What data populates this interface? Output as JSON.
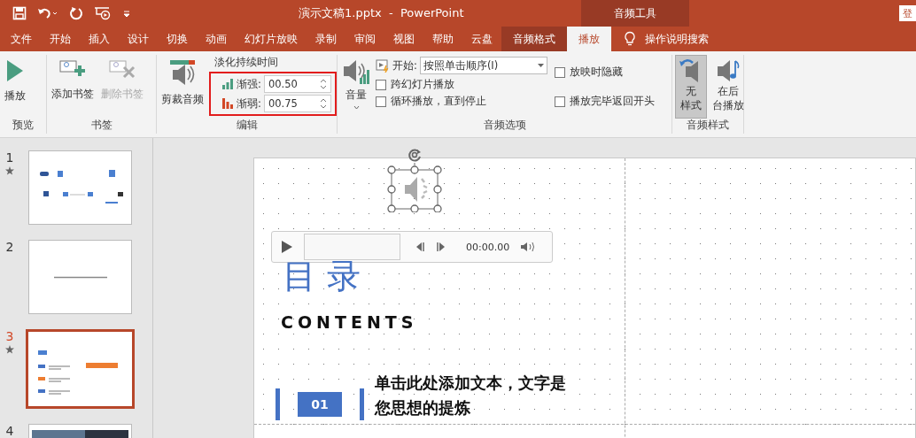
{
  "title_bar": {
    "title": "演示文稿1.pptx  -  PowerPoint",
    "context_group": "音频工具",
    "account": "登"
  },
  "tabs": [
    {
      "label": "文件",
      "selected": false,
      "contextual": false
    },
    {
      "label": "开始",
      "selected": false,
      "contextual": false
    },
    {
      "label": "插入",
      "selected": false,
      "contextual": false
    },
    {
      "label": "设计",
      "selected": false,
      "contextual": false
    },
    {
      "label": "切换",
      "selected": false,
      "contextual": false
    },
    {
      "label": "动画",
      "selected": false,
      "contextual": false
    },
    {
      "label": "幻灯片放映",
      "selected": false,
      "contextual": false
    },
    {
      "label": "录制",
      "selected": false,
      "contextual": false
    },
    {
      "label": "审阅",
      "selected": false,
      "contextual": false
    },
    {
      "label": "视图",
      "selected": false,
      "contextual": false
    },
    {
      "label": "帮助",
      "selected": false,
      "contextual": false
    },
    {
      "label": "云盘",
      "selected": false,
      "contextual": false
    },
    {
      "label": "音频格式",
      "selected": false,
      "contextual": true
    },
    {
      "label": "播放",
      "selected": true,
      "contextual": true
    }
  ],
  "tell_me": "操作说明搜索",
  "ribbon": {
    "preview": {
      "label": "预览",
      "play": "播放"
    },
    "bookmarks": {
      "label": "书签",
      "buttons": [
        {
          "label": "添加书签",
          "kind": "add",
          "disabled": false
        },
        {
          "label": "删除书签",
          "kind": "remove",
          "disabled": true
        }
      ]
    },
    "editing": {
      "label": "编辑",
      "trim": "剪裁音频",
      "fade_title": "淡化持续时间",
      "fades": [
        {
          "kind": "in",
          "label": "渐强:",
          "value": "00.50"
        },
        {
          "kind": "out",
          "label": "渐弱:",
          "value": "00.75"
        }
      ]
    },
    "options": {
      "label": "音频选项",
      "volume": "音量",
      "start_label": "开始:",
      "start_value": "按照单击顺序(I)",
      "left_checks": [
        {
          "label": "跨幻灯片播放",
          "checked": false
        },
        {
          "label": "循环播放，直到停止",
          "checked": false
        }
      ],
      "right_checks": [
        {
          "label": "放映时隐藏",
          "checked": false
        },
        {
          "label": "播放完毕返回开头",
          "checked": false
        }
      ]
    },
    "styles": {
      "label": "音频样式",
      "items": [
        {
          "kind": "none",
          "lines": [
            "无",
            "样式"
          ],
          "selected": true
        },
        {
          "kind": "background",
          "lines": [
            "在后",
            "台播放"
          ],
          "selected": false
        }
      ]
    }
  },
  "slides": [
    {
      "number": "1",
      "starred": true,
      "selected": false,
      "kind": "contents"
    },
    {
      "number": "2",
      "starred": false,
      "selected": false,
      "kind": "line"
    },
    {
      "number": "3",
      "starred": true,
      "selected": true,
      "kind": "list"
    },
    {
      "number": "4",
      "starred": false,
      "selected": false,
      "kind": "photo"
    }
  ],
  "slide": {
    "title": "目 录",
    "subtitle": "CONTENTS",
    "player_time": "00:00.00",
    "items": [
      {
        "number": "01",
        "text": "单击此处添加文本，文字是您思想的提炼"
      }
    ]
  }
}
